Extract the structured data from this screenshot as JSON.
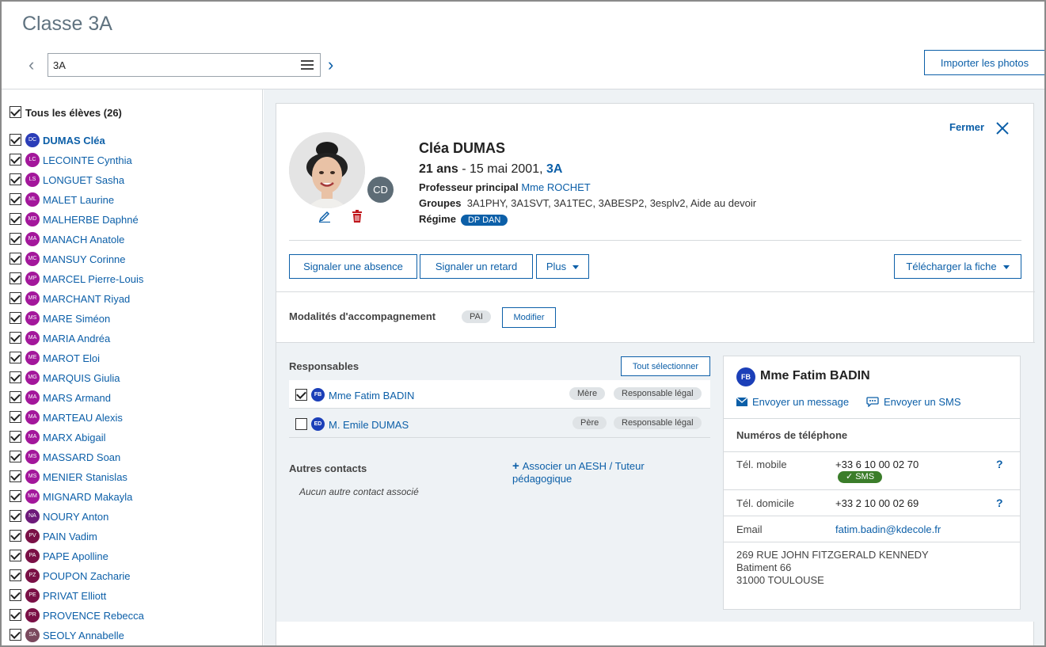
{
  "page": {
    "title": "Classe 3A"
  },
  "class_selector": {
    "value": "3A"
  },
  "import_button": "Importer les photos",
  "sidebar": {
    "all_students_label": "Tous les élèves (26)",
    "students": [
      {
        "initials": "DC",
        "name": "DUMAS Cléa",
        "color": "#2b3db8",
        "active": true
      },
      {
        "initials": "LC",
        "name": "LECOINTE Cynthia",
        "color": "#a3179b"
      },
      {
        "initials": "LS",
        "name": "LONGUET Sasha",
        "color": "#a3179b"
      },
      {
        "initials": "ML",
        "name": "MALET Laurine",
        "color": "#a3179b"
      },
      {
        "initials": "MD",
        "name": "MALHERBE Daphné",
        "color": "#a3179b"
      },
      {
        "initials": "MA",
        "name": "MANACH Anatole",
        "color": "#a3179b"
      },
      {
        "initials": "MC",
        "name": "MANSUY Corinne",
        "color": "#a3179b"
      },
      {
        "initials": "MP",
        "name": "MARCEL Pierre-Louis",
        "color": "#a3179b"
      },
      {
        "initials": "MR",
        "name": "MARCHANT Riyad",
        "color": "#a3179b"
      },
      {
        "initials": "MS",
        "name": "MARE Siméon",
        "color": "#a3179b"
      },
      {
        "initials": "MA",
        "name": "MARIA Andréa",
        "color": "#a3179b"
      },
      {
        "initials": "ME",
        "name": "MAROT Eloi",
        "color": "#a3179b"
      },
      {
        "initials": "MG",
        "name": "MARQUIS Giulia",
        "color": "#a3179b"
      },
      {
        "initials": "MA",
        "name": "MARS Armand",
        "color": "#a3179b"
      },
      {
        "initials": "MA",
        "name": "MARTEAU Alexis",
        "color": "#a3179b"
      },
      {
        "initials": "MA",
        "name": "MARX Abigail",
        "color": "#a3179b"
      },
      {
        "initials": "MS",
        "name": "MASSARD Soan",
        "color": "#a3179b"
      },
      {
        "initials": "MS",
        "name": "MENIER Stanislas",
        "color": "#a3179b"
      },
      {
        "initials": "MM",
        "name": "MIGNARD Makayla",
        "color": "#a3179b"
      },
      {
        "initials": "NA",
        "name": "NOURY Anton",
        "color": "#6d1a7a"
      },
      {
        "initials": "PV",
        "name": "PAIN Vadim",
        "color": "#7a1046"
      },
      {
        "initials": "PA",
        "name": "PAPE Apolline",
        "color": "#7a1046"
      },
      {
        "initials": "PZ",
        "name": "POUPON Zacharie",
        "color": "#7a1046"
      },
      {
        "initials": "PE",
        "name": "PRIVAT Elliott",
        "color": "#7a1046"
      },
      {
        "initials": "PR",
        "name": "PROVENCE Rebecca",
        "color": "#7a1046"
      },
      {
        "initials": "SA",
        "name": "SEOLY Annabelle",
        "color": "#7a4a5e"
      }
    ]
  },
  "student": {
    "avatar_initials": "CD",
    "name": "Cléa DUMAS",
    "age": "21 ans",
    "birth": " - 15 mai 2001, ",
    "class": "3A",
    "prof_label": "Professeur principal",
    "prof_value": "Mme ROCHET",
    "groups_label": "Groupes",
    "groups_value": "3A1PHY, 3A1SVT, 3A1TEC, 3ABESP2, 3esplv2, Aide au devoir",
    "regime_label": "Régime",
    "regime_value": "DP DAN"
  },
  "close_label": "Fermer",
  "actions": {
    "absence": "Signaler une absence",
    "retard": "Signaler un retard",
    "plus": "Plus",
    "telecharger": "Télécharger la fiche"
  },
  "modalites": {
    "label": "Modalités d'accompagnement",
    "tag": "PAI",
    "modify": "Modifier"
  },
  "responsables": {
    "title": "Responsables",
    "select_all": "Tout sélectionner",
    "items": [
      {
        "initials": "FB",
        "name": "Mme Fatim BADIN",
        "relation": "Mère",
        "role": "Responsable légal",
        "checked": true
      },
      {
        "initials": "ED",
        "name": "M. Emile DUMAS",
        "relation": "Père",
        "role": "Responsable légal",
        "checked": false
      }
    ]
  },
  "autres": {
    "title": "Autres contacts",
    "none": "Aucun autre contact associé",
    "associate": "Associer un AESH / Tuteur pédagogique"
  },
  "contact": {
    "initials": "FB",
    "name": "Mme Fatim BADIN",
    "send_message": "Envoyer un message",
    "send_sms": "Envoyer un SMS",
    "phones_title": "Numéros de téléphone",
    "mobile_label": "Tél. mobile",
    "mobile_value": "+33 6 10 00 02 70",
    "sms_badge": "SMS",
    "home_label": "Tél. domicile",
    "home_value": "+33 2 10 00 02 69",
    "email_label": "Email",
    "email_value": "fatim.badin@kdecole.fr",
    "address_line1": "269 RUE JOHN FITZGERALD KENNEDY",
    "address_line2": "Batiment 66",
    "address_line3": "31000 TOULOUSE",
    "help": "?"
  }
}
